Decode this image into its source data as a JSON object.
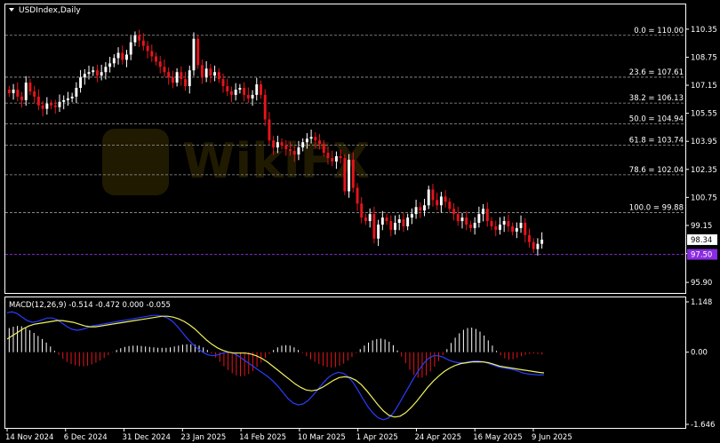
{
  "window": {
    "symbol_title": "USDIndex,Daily",
    "macd_label": "MACD(12,26,9) -0.514 -0.472 0.000 -0.055"
  },
  "colors": {
    "background": "#000000",
    "grid_border": "#ffffff",
    "bull_candle": "#ffffff",
    "bear_candle": "#e8141b",
    "fib_line": "#9a9a9a",
    "current_price_line": "#8a2be2",
    "macd_hist_pos": "#ffffff",
    "macd_hist_neg": "#e8141b",
    "macd_line": "#2a3cff",
    "signal_line": "#f0f060"
  },
  "chart_data": [
    {
      "type": "candlestick",
      "title": "USDIndex,Daily",
      "ylim": [
        95.5,
        110.9
      ],
      "y_ticks": [
        "110.35",
        "108.75",
        "107.15",
        "105.55",
        "103.95",
        "102.35",
        "100.75",
        "99.15",
        "97.55",
        "95.90"
      ],
      "y_tick_values": [
        110.35,
        108.75,
        107.15,
        105.55,
        103.95,
        102.35,
        100.75,
        99.15,
        97.55,
        95.9
      ],
      "x_labels": [
        "14 Nov 2024",
        "6 Dec 2024",
        "31 Dec 2024",
        "23 Jan 2025",
        "14 Feb 2025",
        "10 Mar 2025",
        "1 Apr 2025",
        "24 Apr 2025",
        "16 May 2025",
        "9 Jun 2025"
      ],
      "fibonacci_levels": [
        {
          "label": "0.0 = 110.00",
          "value": 110.0
        },
        {
          "label": "23.6 = 107.61",
          "value": 107.61
        },
        {
          "label": "38.2 = 106.13",
          "value": 106.13
        },
        {
          "label": "50.0 = 104.94",
          "value": 104.94
        },
        {
          "label": "61.8 = 103.74",
          "value": 103.74
        },
        {
          "label": "78.6 = 102.04",
          "value": 102.04
        },
        {
          "label": "100.0 = 99.88",
          "value": 99.88
        }
      ],
      "last_price": {
        "label": "98.34",
        "value": 98.34
      },
      "reference_price": {
        "label": "97.50",
        "value": 97.5
      },
      "close_path": [
        106.7,
        106.9,
        106.5,
        106.3,
        107.3,
        106.8,
        106.5,
        106.0,
        105.8,
        106.1,
        106.0,
        105.9,
        106.2,
        106.3,
        106.4,
        106.5,
        107.0,
        107.6,
        107.8,
        107.9,
        108.0,
        107.7,
        107.9,
        108.2,
        108.4,
        108.7,
        109.0,
        108.6,
        108.9,
        109.6,
        110.0,
        109.7,
        109.4,
        109.1,
        108.8,
        108.5,
        108.2,
        107.9,
        107.6,
        107.3,
        107.9,
        107.5,
        107.1,
        108.0,
        109.8,
        108.3,
        107.6,
        108.1,
        107.7,
        107.9,
        107.5,
        107.1,
        106.8,
        106.6,
        106.9,
        107.0,
        106.6,
        106.4,
        106.6,
        107.2,
        106.6,
        105.2,
        104.0,
        103.6,
        103.9,
        103.7,
        103.5,
        103.4,
        103.2,
        103.6,
        103.9,
        104.1,
        104.2,
        104.0,
        103.8,
        103.3,
        103.0,
        102.8,
        103.1,
        103.0,
        101.1,
        102.9,
        101.3,
        100.4,
        99.6,
        99.4,
        99.8,
        98.4,
        99.2,
        99.6,
        99.4,
        98.9,
        99.3,
        99.5,
        99.1,
        99.6,
        99.8,
        100.2,
        100.0,
        100.3,
        101.2,
        100.6,
        100.3,
        100.8,
        100.5,
        100.1,
        99.8,
        99.4,
        99.6,
        99.2,
        99.0,
        99.3,
        99.8,
        100.1,
        99.4,
        99.1,
        98.9,
        99.2,
        99.4,
        99.1,
        98.8,
        99.0,
        99.3,
        98.6,
        98.2,
        97.8,
        98.1,
        98.34
      ]
    },
    {
      "type": "histogram+line",
      "title": "MACD(12,26,9)",
      "values_text": "-0.514 -0.472 0.000 -0.055",
      "y_ticks": [
        "1.148",
        "0.00",
        "-1.646"
      ],
      "y_tick_values": [
        1.148,
        0.0,
        -1.646
      ],
      "histogram": [
        0.55,
        0.58,
        0.6,
        0.59,
        0.55,
        0.5,
        0.44,
        0.37,
        0.3,
        0.22,
        0.13,
        0.03,
        -0.06,
        -0.15,
        -0.22,
        -0.27,
        -0.3,
        -0.32,
        -0.32,
        -0.31,
        -0.28,
        -0.24,
        -0.19,
        -0.13,
        -0.07,
        -0.01,
        0.05,
        0.09,
        0.12,
        0.14,
        0.15,
        0.15,
        0.14,
        0.13,
        0.12,
        0.11,
        0.1,
        0.1,
        0.1,
        0.11,
        0.13,
        0.15,
        0.17,
        0.18,
        0.18,
        0.17,
        0.15,
        0.11,
        0.05,
        -0.03,
        -0.12,
        -0.22,
        -0.32,
        -0.41,
        -0.48,
        -0.53,
        -0.55,
        -0.54,
        -0.5,
        -0.43,
        -0.34,
        -0.24,
        -0.13,
        -0.04,
        0.05,
        0.11,
        0.15,
        0.16,
        0.15,
        0.11,
        0.05,
        -0.02,
        -0.09,
        -0.16,
        -0.22,
        -0.27,
        -0.31,
        -0.34,
        -0.35,
        -0.34,
        -0.31,
        -0.26,
        -0.19,
        -0.11,
        -0.02,
        0.07,
        0.15,
        0.22,
        0.27,
        0.3,
        0.31,
        0.29,
        0.24,
        0.16,
        0.04,
        -0.1,
        -0.25,
        -0.4,
        -0.52,
        -0.58,
        -0.58,
        -0.53,
        -0.44,
        -0.33,
        -0.2,
        -0.07,
        0.07,
        0.21,
        0.33,
        0.43,
        0.51,
        0.55,
        0.56,
        0.53,
        0.47,
        0.38,
        0.27,
        0.15,
        0.03,
        -0.07,
        -0.14,
        -0.17,
        -0.16,
        -0.13,
        -0.09,
        -0.06,
        -0.04,
        -0.03,
        -0.04,
        -0.05
      ],
      "macd_line": [
        0.9,
        0.92,
        0.88,
        0.8,
        0.72,
        0.68,
        0.7,
        0.74,
        0.78,
        0.78,
        0.74,
        0.66,
        0.58,
        0.52,
        0.5,
        0.52,
        0.56,
        0.6,
        0.62,
        0.64,
        0.66,
        0.68,
        0.7,
        0.72,
        0.74,
        0.76,
        0.78,
        0.8,
        0.82,
        0.84,
        0.84,
        0.82,
        0.78,
        0.7,
        0.58,
        0.44,
        0.3,
        0.18,
        0.08,
        0.0,
        -0.06,
        -0.08,
        -0.06,
        -0.02,
        0.0,
        -0.02,
        -0.08,
        -0.16,
        -0.24,
        -0.32,
        -0.4,
        -0.48,
        -0.56,
        -0.66,
        -0.78,
        -0.92,
        -1.06,
        -1.16,
        -1.2,
        -1.18,
        -1.1,
        -0.98,
        -0.84,
        -0.7,
        -0.58,
        -0.5,
        -0.46,
        -0.48,
        -0.56,
        -0.7,
        -0.88,
        -1.08,
        -1.26,
        -1.4,
        -1.5,
        -1.54,
        -1.5,
        -1.38,
        -1.2,
        -1.0,
        -0.8,
        -0.6,
        -0.42,
        -0.26,
        -0.14,
        -0.08,
        -0.08,
        -0.12,
        -0.18,
        -0.22,
        -0.24,
        -0.24,
        -0.22,
        -0.2,
        -0.2,
        -0.22,
        -0.26,
        -0.3,
        -0.34,
        -0.36,
        -0.38,
        -0.4,
        -0.44,
        -0.48,
        -0.5,
        -0.51,
        -0.52,
        -0.514
      ],
      "signal_line": [
        0.3,
        0.38,
        0.46,
        0.54,
        0.6,
        0.64,
        0.66,
        0.68,
        0.7,
        0.72,
        0.72,
        0.7,
        0.68,
        0.64,
        0.6,
        0.58,
        0.58,
        0.6,
        0.62,
        0.64,
        0.66,
        0.68,
        0.7,
        0.72,
        0.74,
        0.76,
        0.78,
        0.8,
        0.82,
        0.82,
        0.8,
        0.76,
        0.7,
        0.62,
        0.52,
        0.4,
        0.28,
        0.18,
        0.1,
        0.04,
        0.0,
        -0.02,
        -0.02,
        -0.02,
        -0.04,
        -0.08,
        -0.14,
        -0.22,
        -0.32,
        -0.42,
        -0.52,
        -0.62,
        -0.72,
        -0.8,
        -0.86,
        -0.88,
        -0.86,
        -0.8,
        -0.72,
        -0.64,
        -0.58,
        -0.56,
        -0.58,
        -0.64,
        -0.74,
        -0.88,
        -1.04,
        -1.2,
        -1.34,
        -1.44,
        -1.48,
        -1.46,
        -1.38,
        -1.26,
        -1.12,
        -0.96,
        -0.8,
        -0.66,
        -0.54,
        -0.44,
        -0.36,
        -0.3,
        -0.26,
        -0.24,
        -0.22,
        -0.22,
        -0.22,
        -0.24,
        -0.28,
        -0.32,
        -0.34,
        -0.36,
        -0.38,
        -0.4,
        -0.42,
        -0.44,
        -0.46,
        -0.472
      ]
    }
  ]
}
